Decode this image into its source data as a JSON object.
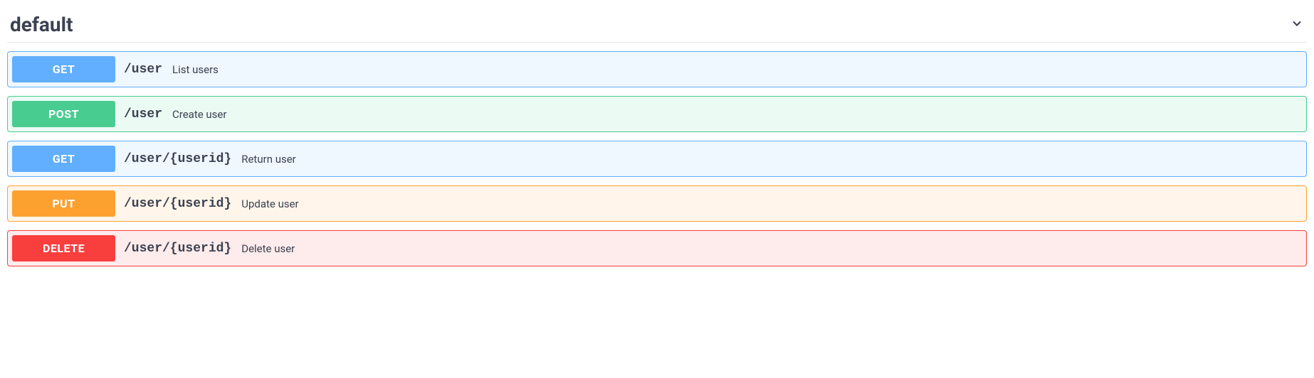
{
  "section": {
    "title": "default"
  },
  "operations": [
    {
      "method": "GET",
      "class": "get",
      "path": "/user",
      "description": "List users"
    },
    {
      "method": "POST",
      "class": "post",
      "path": "/user",
      "description": "Create user"
    },
    {
      "method": "GET",
      "class": "get",
      "path": "/user/{userid}",
      "description": "Return user"
    },
    {
      "method": "PUT",
      "class": "put",
      "path": "/user/{userid}",
      "description": "Update user"
    },
    {
      "method": "DELETE",
      "class": "delete",
      "path": "/user/{userid}",
      "description": "Delete user"
    }
  ]
}
